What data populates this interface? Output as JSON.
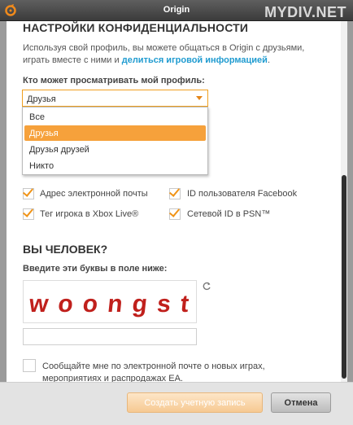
{
  "window": {
    "title": "Origin",
    "watermark": "MYDIV.NET"
  },
  "privacy": {
    "heading": "НАСТРОЙКИ КОНФИДЕНЦИАЛЬНОСТИ",
    "description_part1": "Используя свой профиль, вы можете общаться в Origin с друзьями, играть вместе с ними и ",
    "description_link": "делиться игровой информацией",
    "description_part2": ".",
    "profile_label": "Кто может просматривать мой профиль:",
    "select_value": "Друзья",
    "options": [
      "Все",
      "Друзья",
      "Друзья друзей",
      "Никто"
    ],
    "selected_option": "Друзья"
  },
  "searchable": {
    "items": [
      {
        "label": "Адрес электронной почты",
        "checked": true
      },
      {
        "label": "ID пользователя Facebook",
        "checked": true
      },
      {
        "label": "Тег игрока в Xbox Live®",
        "checked": true
      },
      {
        "label": "Сетевой ID в PSN™",
        "checked": true
      }
    ]
  },
  "human": {
    "heading": "ВЫ ЧЕЛОВЕК?",
    "label": "Введите эти буквы в поле ниже:",
    "captcha_text": "woongst",
    "input_value": "",
    "refresh_icon": "refresh-icon"
  },
  "newsletter": {
    "text": "Сообщайте мне по электронной почте о новых играх, мероприятиях и распродажах EA.",
    "checked": false
  },
  "buttons": {
    "create": "Создать учетную запись",
    "cancel": "Отмена"
  },
  "colors": {
    "accent": "#f6a13b",
    "link": "#1f9bd0",
    "titlebar": "#4a4a4a"
  }
}
